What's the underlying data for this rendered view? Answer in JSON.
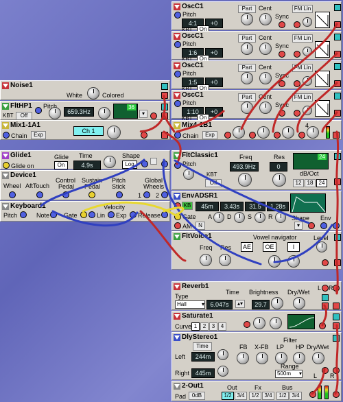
{
  "modules": {
    "osc1": {
      "title": "OscC1",
      "pitch": "Pitch",
      "val1": "4:1",
      "val2": "+0",
      "kbt": "KBT",
      "on": "On",
      "part": "Part",
      "cent": "Cent",
      "sync": "Sync",
      "fmlin": "FM Lin"
    },
    "osc2": {
      "title": "OscC1",
      "pitch": "Pitch",
      "val1": "1:6",
      "val2": "+0",
      "kbt": "KBT",
      "on": "On",
      "part": "Part",
      "cent": "Cent",
      "sync": "Sync",
      "fmlin": "FM Lin"
    },
    "osc3": {
      "title": "OscC1",
      "pitch": "Pitch",
      "val1": "1:5",
      "val2": "+0",
      "kbt": "KBT",
      "on": "On",
      "part": "Part",
      "cent": "Cent",
      "sync": "Sync",
      "fmlin": "FM Lin"
    },
    "osc4": {
      "title": "OscC1",
      "pitch": "Pitch",
      "val1": "1:10",
      "val2": "+0",
      "kbt": "KBT",
      "on": "On",
      "part": "Part",
      "cent": "Cent",
      "sync": "Sync",
      "fmlin": "FM Lin"
    },
    "noise": {
      "title": "Noise1",
      "white": "White",
      "colored": "Colored"
    },
    "flthp": {
      "title": "FltHP1",
      "pitch": "Pitch",
      "freq": "659.3Hz",
      "kbt": "KBT",
      "off": "Off",
      "slope": "36"
    },
    "mix1": {
      "title": "Mix1-1A1",
      "chain": "Chain",
      "exp": "Exp",
      "ch": "Ch 1"
    },
    "mix4": {
      "title": "Mix4-1B1",
      "chain": "Chain",
      "exp": "Exp",
      "n4": "4"
    },
    "glide": {
      "title": "Glide1",
      "glideon": "Glide on",
      "glide": "Glide",
      "on": "On",
      "time": "Time",
      "timeval": "4.9s",
      "shape": "Shape",
      "log": "Log"
    },
    "device": {
      "title": "Device1",
      "wheel": "Wheel",
      "aft": "AftTouch",
      "control": "Control",
      "pedal": "Pedal",
      "sustain": "Sustain",
      "pedal2": "Pedal",
      "pitch": "Pitch",
      "stick": "Stick",
      "global": "Global",
      "wheels": "Wheels",
      "n1": "1",
      "n2": "2"
    },
    "keyboard": {
      "title": "Keyboard1",
      "pitch": "Pitch",
      "note": "Note",
      "gate": "Gate",
      "velocity": "Velocity",
      "lin": "Lin",
      "exp": "Exp",
      "release": "Release"
    },
    "fltclassic": {
      "title": "FltClassic1",
      "pitch": "Pitch",
      "kbt": "KBT",
      "off": "Off",
      "freq": "Freq",
      "freqval": "493.9Hz",
      "res": "Res",
      "resval": "0",
      "dboct": "dB/Oct",
      "s12": "12",
      "s18": "18",
      "s24": "24",
      "graph": "24"
    },
    "envadsr": {
      "title": "EnvADSR1",
      "kb": "KB",
      "a": "A",
      "d": "D",
      "s": "S",
      "r": "R",
      "gate": "Gate",
      "am": "AM",
      "n": "N",
      "aval": "45m",
      "dval": "3.43s",
      "sval": "31.5",
      "rval": "1.28s",
      "shape": "Shape",
      "env": "Env"
    },
    "fltvoice": {
      "title": "FltVoice1",
      "freq": "Freq",
      "res": "Res",
      "vowel": "Vowel navigator",
      "v1": "AE",
      "v2": "OE",
      "v3": "I",
      "level": "Level"
    },
    "reverb": {
      "title": "Reverb1",
      "type": "Type",
      "hall": "Hall",
      "time": "Time",
      "timeval": "6.047s",
      "bright": "Brightness",
      "brightval": "29.7",
      "drywet": "Dry/Wet",
      "l": "L",
      "r": "R"
    },
    "saturate": {
      "title": "Saturate1",
      "curve": "Curve",
      "c1": "1",
      "c2": "2",
      "c3": "3",
      "c4": "4"
    },
    "dly": {
      "title": "DlyStereo1",
      "time": "Time",
      "left": "Left",
      "leftval": "244m",
      "right": "Right",
      "rightval": "445m",
      "fb": "FB",
      "xfb": "X-FB",
      "filter": "Filter",
      "lp": "LP",
      "hp": "HP",
      "drywet": "Dry/Wet",
      "range": "Range",
      "rangeval": "500m",
      "l": "L",
      "r": "R"
    },
    "out": {
      "title": "2-Out1",
      "pad": "Pad",
      "padval": "0dB",
      "outl": "Out",
      "fx": "Fx",
      "bus": "Bus",
      "o1": "1/2",
      "o2": "3/4",
      "f1": "1/2",
      "f2": "3/4",
      "b1": "1/2",
      "b2": "3/4"
    }
  },
  "colors": {
    "red": "#c8323a",
    "green": "#3aa040",
    "blue": "#3a4ec8",
    "cable_red": "#c02828",
    "cable_blue": "#3040c0",
    "cable_yellow": "#e8d830"
  }
}
